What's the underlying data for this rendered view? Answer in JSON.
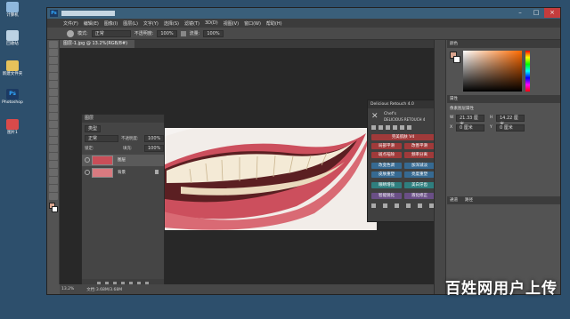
{
  "desktop": {
    "icons": [
      {
        "label": "计算机",
        "icon": "computer-icon"
      },
      {
        "label": "回收站",
        "icon": "recycle-bin-icon"
      },
      {
        "label": "新建文件夹",
        "icon": "folder-icon"
      },
      {
        "label": "Photoshop",
        "icon": "photoshop-icon"
      },
      {
        "label": "图片1",
        "icon": "image-file-icon"
      }
    ]
  },
  "photoshop": {
    "logo": "Ps",
    "menu": [
      "文件(F)",
      "编辑(E)",
      "图像(I)",
      "图层(L)",
      "文字(Y)",
      "选择(S)",
      "滤镜(T)",
      "3D(D)",
      "视图(V)",
      "窗口(W)",
      "帮助(H)"
    ],
    "options": {
      "mode_label": "模式:",
      "mode_value": "正常",
      "opacity_label": "不透明度:",
      "opacity_value": "100%",
      "flow_label": "流量:",
      "flow_value": "100%"
    },
    "document_tab": "图层-1.jpg @ 13.2%(RGB/8#)",
    "status": {
      "zoom": "13.2%",
      "doc": "文档:3.68M/3.68M"
    }
  },
  "layers_panel": {
    "title": "图层",
    "kind_value": "类型",
    "blend_value": "正常",
    "opacity_label": "不透明度:",
    "opacity_value": "100%",
    "lock_label": "锁定:",
    "fill_label": "填充:",
    "fill_value": "100%",
    "layers": [
      {
        "name": "图层"
      },
      {
        "name": "背景"
      }
    ]
  },
  "retouch_panel": {
    "title": "Delicious Retouch 4.0",
    "brand_line1": "Chef's",
    "brand_line2": "DELICIOUS RETOUCH 4",
    "buttons": [
      {
        "label": "完美肌肤 V4",
        "style": "red"
      },
      {
        "label": "局部平滑",
        "style": "red"
      },
      {
        "label": "改善平滑",
        "style": "red"
      },
      {
        "label": "斑点祛除",
        "style": "red"
      },
      {
        "label": "频率分离",
        "style": "red"
      },
      {
        "label": "改变色调",
        "style": "blue"
      },
      {
        "label": "加深减淡",
        "style": "blue"
      },
      {
        "label": "皮肤重塑",
        "style": "blue"
      },
      {
        "label": "亮度重塑",
        "style": "blue"
      },
      {
        "label": "眼睛增强",
        "style": "teal"
      },
      {
        "label": "美白牙齿",
        "style": "teal"
      },
      {
        "label": "智能锐化",
        "style": "purple"
      },
      {
        "label": "液化修正",
        "style": "purple"
      }
    ]
  },
  "right_panels": {
    "color_title": "颜色",
    "properties_title": "属性",
    "properties_sub": "像素图层属性",
    "width_label": "W",
    "width_value": "21.33 厘米",
    "height_label": "H",
    "height_value": "14.22 厘米",
    "x_label": "X",
    "x_value": "0 厘米",
    "y_label": "Y",
    "y_value": "0 厘米",
    "bottom_tabs": [
      "通道",
      "路径"
    ],
    "accent_color": "#ff6a00"
  },
  "watermark": "百姓网用户上传"
}
